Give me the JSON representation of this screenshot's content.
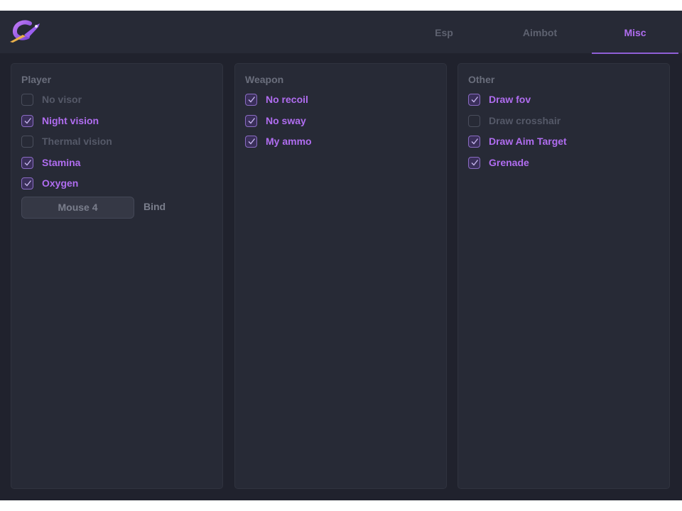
{
  "header": {
    "logo_icon": "rocket-logo-icon",
    "accent_color": "#b06df0",
    "tabs": [
      {
        "label": "Esp",
        "active": false
      },
      {
        "label": "Aimbot",
        "active": false
      },
      {
        "label": "Misc",
        "active": true
      }
    ]
  },
  "panels": {
    "player": {
      "title": "Player",
      "options": [
        {
          "label": "No visor",
          "checked": false
        },
        {
          "label": "Night vision",
          "checked": true
        },
        {
          "label": "Thermal vision",
          "checked": false
        },
        {
          "label": "Stamina",
          "checked": true
        },
        {
          "label": "Oxygen",
          "checked": true
        }
      ],
      "bind": {
        "key": "Mouse 4",
        "label": "Bind"
      }
    },
    "weapon": {
      "title": "Weapon",
      "options": [
        {
          "label": "No recoil",
          "checked": true
        },
        {
          "label": "No sway",
          "checked": true
        },
        {
          "label": "My ammo",
          "checked": true
        }
      ]
    },
    "other": {
      "title": "Other",
      "options": [
        {
          "label": "Draw fov",
          "checked": true
        },
        {
          "label": "Draw crosshair",
          "checked": false
        },
        {
          "label": "Draw Aim Target",
          "checked": true
        },
        {
          "label": "Grenade",
          "checked": true
        }
      ]
    }
  }
}
